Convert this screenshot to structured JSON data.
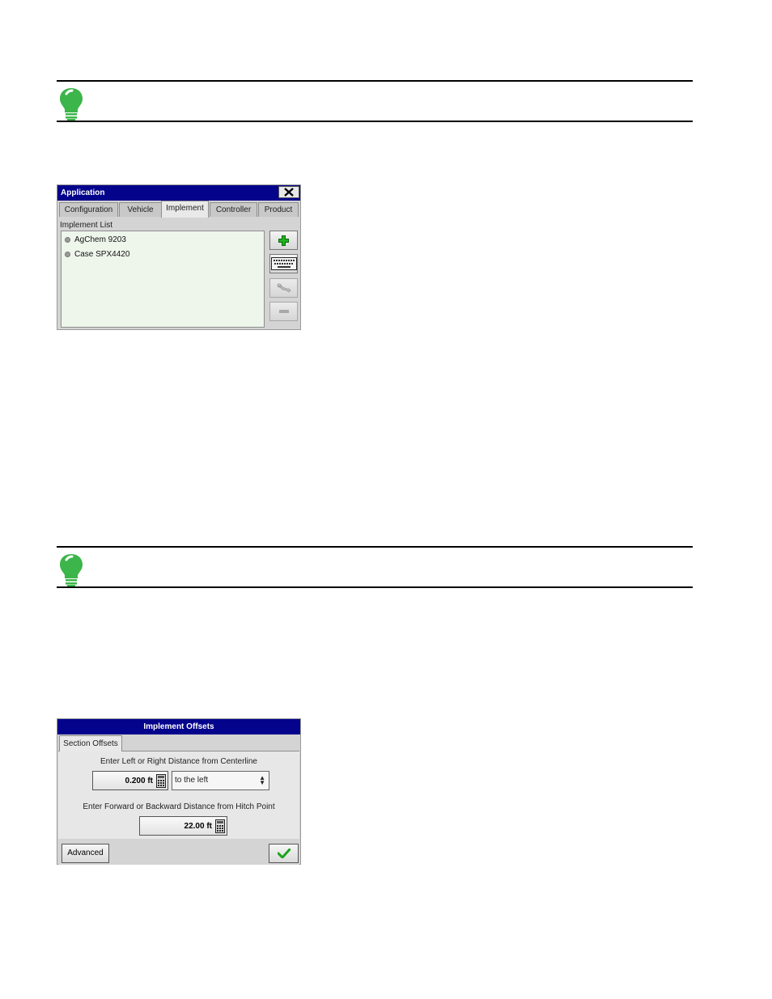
{
  "colors": {
    "titlebar": "#04038c",
    "tip_icon": "#3cb54a",
    "list_bg": "#eef6ec"
  },
  "notes": [
    {
      "icon": "lightbulb-icon"
    },
    {
      "icon": "lightbulb-icon"
    }
  ],
  "application": {
    "title": "Application",
    "tabs": [
      {
        "label": "Configuration",
        "active": false
      },
      {
        "label": "Vehicle",
        "active": false
      },
      {
        "label": "Implement",
        "active": true
      },
      {
        "label": "Controller",
        "active": false
      },
      {
        "label": "Product",
        "active": false
      }
    ],
    "list_label": "Implement List",
    "items": [
      "AgChem 9203",
      "Case SPX4420"
    ],
    "side_buttons": [
      {
        "icon": "plus-icon",
        "enabled": true
      },
      {
        "icon": "keyboard-icon",
        "enabled": true
      },
      {
        "icon": "wrench-icon",
        "enabled": false
      },
      {
        "icon": "minus-icon",
        "enabled": false
      }
    ]
  },
  "offsets": {
    "title": "Implement Offsets",
    "tab": "Section Offsets",
    "lateral_label": "Enter Left or Right Distance from Centerline",
    "lateral_value": "0.200 ft",
    "direction": "to the left",
    "fore_aft_label": "Enter Forward or Backward Distance from Hitch Point",
    "fore_aft_value": "22.00 ft",
    "advanced_label": "Advanced",
    "ok_icon": "checkmark-icon"
  }
}
